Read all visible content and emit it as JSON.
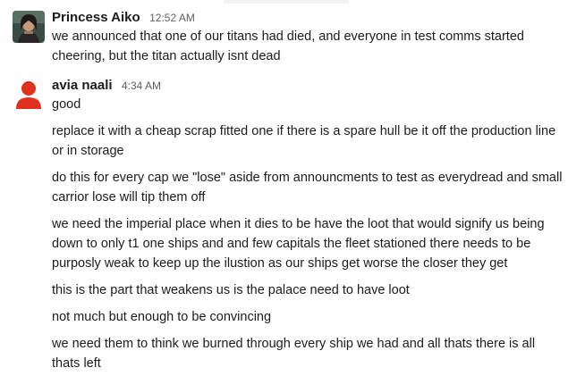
{
  "messages": [
    {
      "sender": "Princess Aiko",
      "time": "12:52 AM",
      "avatar_icon": "profile-photo-icon",
      "lines": [
        "we announced that one of our titans had died, and everyone in test comms started cheering, but the titan actually isnt dead"
      ]
    },
    {
      "sender": "avia naali",
      "time": "4:34 AM",
      "avatar_icon": "default-user-icon",
      "avatar_color": "#e0301e",
      "lines": [
        "good",
        "replace it with a cheap scrap fitted one if there is a spare hull be it off the production line or in storage",
        "do this for every cap we \"lose\" aside from announcments to test as everydread and small carrior lose will tip them off",
        "we need the imperial place when it dies to be have the loot that would signify us being down to only t1 one ships and and few capitals the fleet stationed there needs to be purposly weak to keep up the ilustion as our ships get worse the closer they get",
        "this is the part that weakens us is the palace need to have loot",
        "not much but enough to be convincing",
        "we need them to think we burned through every ship we had and all thats there is all thats left"
      ]
    }
  ]
}
